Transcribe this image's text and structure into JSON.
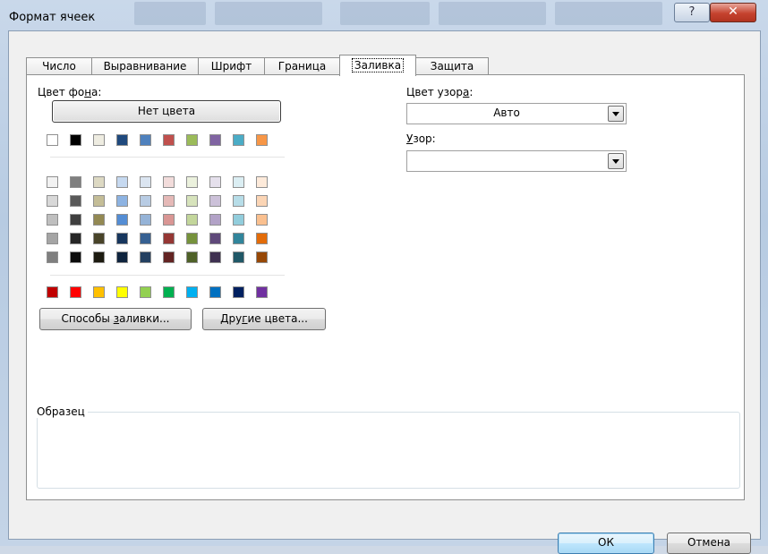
{
  "window": {
    "title": "Формат ячеек",
    "help_label": "?",
    "close_label": "✕"
  },
  "tabs": [
    {
      "label": "Число"
    },
    {
      "label": "Выравнивание"
    },
    {
      "label": "Шрифт"
    },
    {
      "label": "Граница"
    },
    {
      "label": "Заливка",
      "active": true
    },
    {
      "label": "Защита"
    }
  ],
  "fill": {
    "bg_color_label_pre": "Цвет фо",
    "bg_color_label_accel": "н",
    "bg_color_label_post": "а:",
    "no_color_button": "Нет цвета",
    "palette_row_theme": [
      "#ffffff",
      "#000000",
      "#eeece1",
      "#1f497d",
      "#4f81bd",
      "#c0504d",
      "#9bbb59",
      "#8064a2",
      "#4bacc6",
      "#f79646"
    ],
    "palette_rows_tints": [
      [
        "#f2f2f2",
        "#7f7f7f",
        "#ddd9c3",
        "#c6d9f0",
        "#dbe5f1",
        "#f2dcdb",
        "#ebf1dd",
        "#e5e0ec",
        "#dbeef3",
        "#fdeada"
      ],
      [
        "#d8d8d8",
        "#595959",
        "#c4bd97",
        "#8db3e2",
        "#b8cce4",
        "#e5b9b7",
        "#d7e3bc",
        "#ccc1d9",
        "#b7dde8",
        "#fbd5b5"
      ],
      [
        "#bfbfbf",
        "#3f3f3f",
        "#938953",
        "#548dd4",
        "#95b3d7",
        "#d99694",
        "#c3d69b",
        "#b2a2c7",
        "#92cddc",
        "#fac08f"
      ],
      [
        "#a5a5a5",
        "#262626",
        "#494429",
        "#17365d",
        "#366092",
        "#953734",
        "#76923c",
        "#5f497a",
        "#31859b",
        "#e36c09"
      ],
      [
        "#7f7f7f",
        "#0c0c0c",
        "#1d1b10",
        "#0f243e",
        "#244061",
        "#632423",
        "#4f6128",
        "#3f3151",
        "#205867",
        "#974806"
      ]
    ],
    "palette_row_standard": [
      "#c00000",
      "#ff0000",
      "#ffc000",
      "#ffff00",
      "#92d050",
      "#00b050",
      "#00b0f0",
      "#0070c0",
      "#002060",
      "#7030a0"
    ],
    "fill_effects_pre": "Способы ",
    "fill_effects_accel": "з",
    "fill_effects_post": "аливки...",
    "more_colors_pre": "Дру",
    "more_colors_accel": "г",
    "more_colors_post": "ие цвета...",
    "pattern_color_label_pre": "Цвет узор",
    "pattern_color_label_accel": "а",
    "pattern_color_label_post": ":",
    "pattern_color_value": "Авто",
    "pattern_label_accel": "У",
    "pattern_label_post": "зор:",
    "pattern_value": "",
    "sample_label": "Образец"
  },
  "footer": {
    "ok_label": "ОК",
    "cancel_label": "Отмена"
  }
}
